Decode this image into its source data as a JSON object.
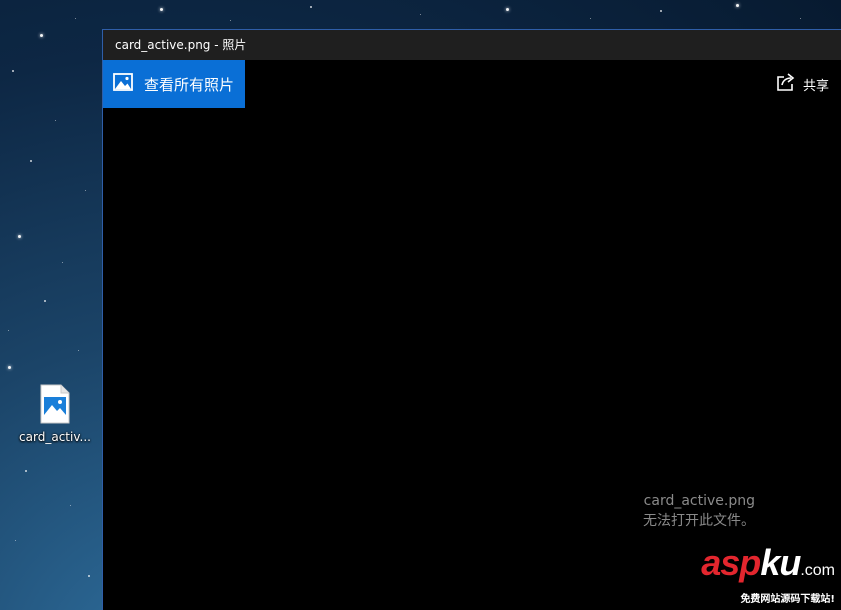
{
  "desktop": {
    "icon": {
      "label": "card_activ...",
      "icon": "image-file-icon"
    }
  },
  "window": {
    "title": "card_active.png - 照片",
    "toolbar": {
      "all_photos_label": "查看所有照片",
      "all_photos_icon": "photo-gallery-icon",
      "share_label": "共享",
      "share_icon": "share-icon"
    },
    "viewer": {
      "filename": "card_active.png",
      "error_message": "无法打开此文件。"
    }
  },
  "watermark": {
    "brand_red": "asp",
    "brand_white": "ku",
    "brand_suffix": ".com",
    "tagline": "免费网站源码下载站!"
  },
  "colors": {
    "accent": "#0a6fd6",
    "titlebar": "#1f1f1f",
    "viewer_bg": "#000000",
    "message_text": "#8a8a8a",
    "watermark_red": "#e3262e"
  }
}
